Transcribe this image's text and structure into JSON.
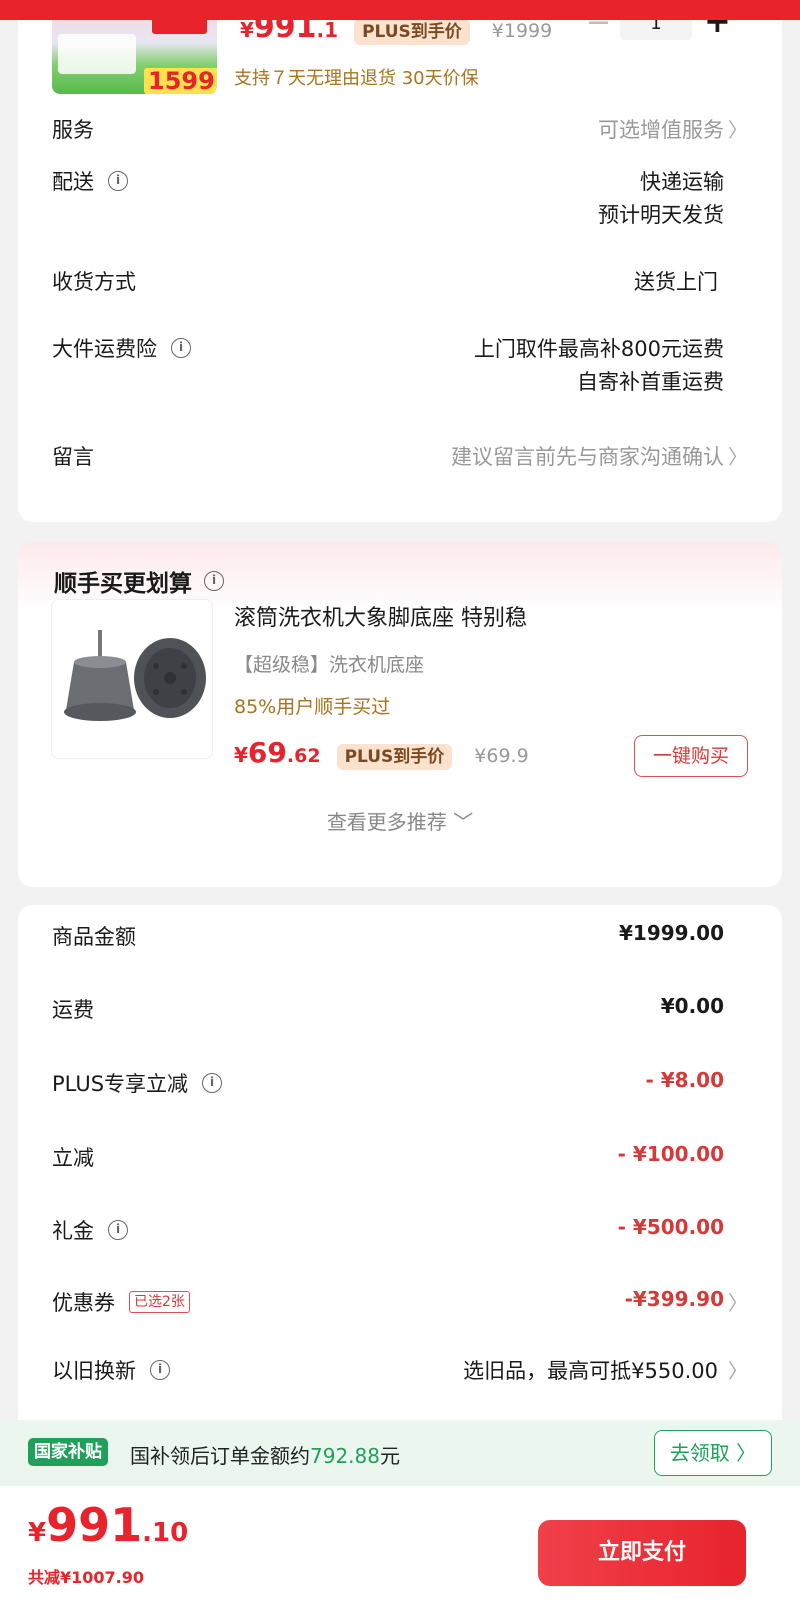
{
  "product": {
    "price_currency": "¥",
    "price_int": "991",
    "price_dec": ".1",
    "plus_tag": "PLUS到手价",
    "original_price": "¥1999",
    "quantity": "1",
    "return_note": "支持７天无理由退货 30天价保",
    "thumb_price": "1599"
  },
  "details": {
    "service_label": "服务",
    "service_value": "可选增值服务",
    "delivery_label": "配送",
    "delivery_value1": "快递运输",
    "delivery_value2": "预计明天发货",
    "receive_label": "收货方式",
    "receive_value": "送货上门",
    "insurance_label": "大件运费险",
    "insurance_value1": "上门取件最高补800元运费",
    "insurance_value2": "自寄补首重运费",
    "message_label": "留言",
    "message_placeholder": "建议留言前先与商家沟通确认"
  },
  "recommend": {
    "title": "顺手买更划算",
    "name": "滚筒洗衣机大象脚底座 特别稳",
    "sub": "【超级稳】洗衣机底座",
    "percent": "85%用户顺手买过",
    "price_currency": "¥",
    "price_int": "69",
    "price_dec": ".62",
    "plus_tag": "PLUS到手价",
    "original_price": "¥69.9",
    "buy_label": "一键购买",
    "more_label": "查看更多推荐"
  },
  "fees": {
    "goods_label": "商品金额",
    "goods_value": "¥1999.00",
    "shipping_label": "运费",
    "shipping_value": "¥0.00",
    "plus_label": "PLUS专享立减",
    "plus_value": "- ¥8.00",
    "discount_label": "立减",
    "discount_value": "- ¥100.00",
    "gift_label": "礼金",
    "gift_value": "- ¥500.00",
    "coupon_label": "优惠券",
    "coupon_tag": "已选2张",
    "coupon_value": "-¥399.90",
    "tradein_label": "以旧换新",
    "tradein_value": "选旧品，最高可抵¥550.00"
  },
  "subsidy": {
    "tag": "国家补贴",
    "text_prefix": "国补领后订单金额约",
    "amount": "792.88",
    "text_suffix": "元",
    "button": "去领取 〉"
  },
  "footer": {
    "currency": "¥",
    "total_int": "991",
    "total_dec": ".10",
    "saved": "共减¥1007.90",
    "pay_label": "立即支付"
  },
  "colors": {
    "accent_red": "#e8232c",
    "subsidy_green": "#20a05a",
    "gold": "#a8741f"
  }
}
